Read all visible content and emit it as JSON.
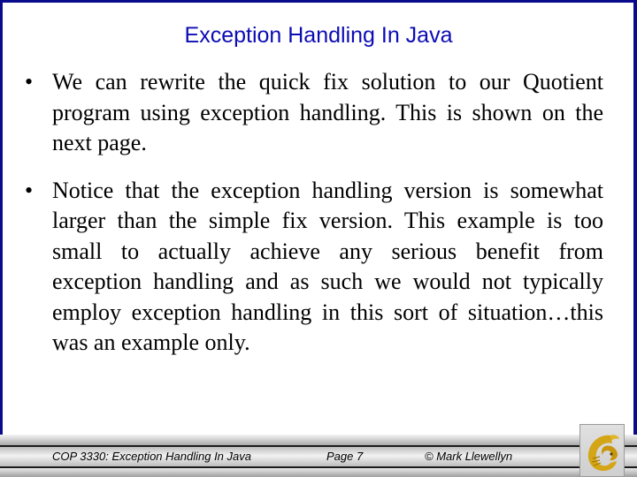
{
  "slide": {
    "title": "Exception Handling In Java",
    "bullets": [
      {
        "marker": "•",
        "text": "We can rewrite the quick fix solution to our Quotient program using exception handling.  This is shown on the next page."
      },
      {
        "marker": "•",
        "text": "Notice that the exception handling version is somewhat larger than the simple fix version.  This example is too small to actually achieve any serious benefit from exception handling and as such we would not typically employ exception handling in this sort of situation…this was an example only."
      }
    ]
  },
  "footer": {
    "course": "COP 3330:  Exception Handling In Java",
    "page": "Page 7",
    "author": "© Mark Llewellyn",
    "logo": "pegasus-logo-icon"
  },
  "colors": {
    "border": "#0a0a8c",
    "title": "#0c0cb4",
    "logo_gold": "#d4a514"
  }
}
